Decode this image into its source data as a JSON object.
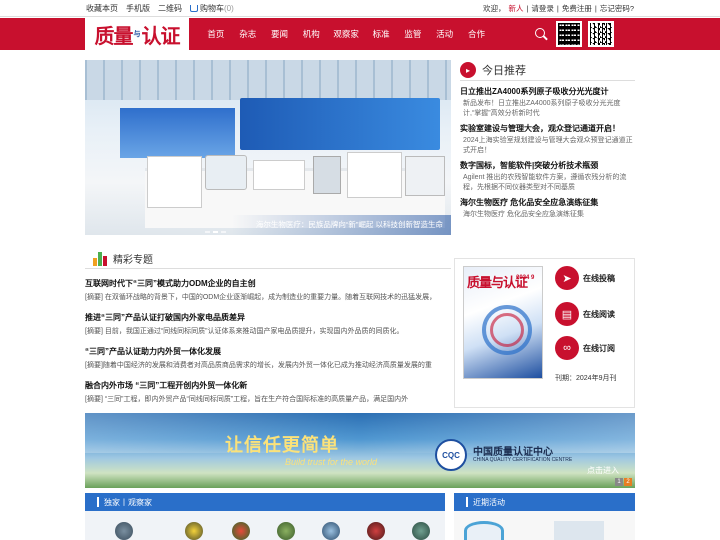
{
  "topbar": {
    "links": [
      "收藏本页",
      "手机版",
      "二维码"
    ],
    "cart_label": "购物车",
    "cart_count": "(0)",
    "welcome": "欢迎，",
    "user": "新人",
    "login_prompt": "请登录",
    "register": "免费注册",
    "forgot": "忘记密码?"
  },
  "logo": {
    "part1": "质量",
    "mid": "与",
    "part2": "认证"
  },
  "nav": {
    "items": [
      "首页",
      "杂志",
      "要闻",
      "机构",
      "观察家",
      "标准",
      "监管",
      "活动",
      "合作"
    ]
  },
  "banner": {
    "caption": "海尔生物医疗：民族品牌向“新”崛起 以科技创新智造生命"
  },
  "today": {
    "title": "今日推荐",
    "items": [
      {
        "headline": "日立推出ZA4000系列原子吸收分光光度计",
        "summary": "新品发布！日立推出ZA4000系列原子吸收分光光度计,“掌握”高效分析新时代"
      },
      {
        "headline": "实验室建设与管理大会，观众登记通道开启！",
        "summary": "2024上海实验室规划建设与管理大会观众预登记通道正式开启！"
      },
      {
        "headline": "数字国标，智能软件|突破分析技术瓶颈",
        "summary": "Agilent 推出的农残智能软件方案，遵循农残分析的流程，先根据不同仪器类型对不同基质"
      },
      {
        "headline": "海尔生物医疗 危化品安全应急演练征集",
        "summary": "海尔生物医疗 危化品安全应急演练征集"
      }
    ]
  },
  "featured": {
    "title": "精彩专题",
    "articles": [
      {
        "headline": "互联网时代下“三同”模式助力ODM企业的自主创",
        "summary": "[摘要] 在双循环战略的背景下，中国的ODM企业逐渐崛起，成为制造业的重要力量。随着互联网技术的迅猛发展，"
      },
      {
        "headline": "推进“三同”产品认证打破国内外家电品质差异",
        "summary": "[摘要] 目前，我国正通过“同线同标同质”认证体系来推动国产家电品质提升，实现国内外品质的同质化。"
      },
      {
        "headline": "“三同”产品认证助力内外贸一体化发展",
        "summary": "[摘要]随着中国经济的发展和消费者对高品质商品需求的增长，发展内外贸一体化已成为推动经济高质量发展的重"
      },
      {
        "headline": "融合内外市场 “三同”工程开创内外贸一体化新",
        "summary": "[摘要] “三同”工程，即内外贸产品“同线同标同质”工程，旨在生产符合国际标准的高质量产品，满足国内外"
      }
    ]
  },
  "magazine": {
    "cover_title": "质量与认证",
    "cover_issue": "2024 9",
    "issue_label": "刊期：2024年9月刊",
    "actions": [
      "在线投稿",
      "在线阅读",
      "在线订阅"
    ]
  },
  "ad": {
    "slogan": "让信任更简单",
    "slogan_en": "Build trust for the world",
    "org": "中国质量认证中心",
    "org_en": "CHINA QUALITY CERTIFICATION CENTRE",
    "org_abbr": "CQC",
    "cta": "点击进入",
    "pages": [
      "1",
      "2"
    ]
  },
  "bottom": {
    "left_title": "独家丨观察家",
    "right_title": "近期活动"
  },
  "colors": {
    "brand_red": "#c8102e",
    "brand_blue": "#2a6fc9"
  }
}
